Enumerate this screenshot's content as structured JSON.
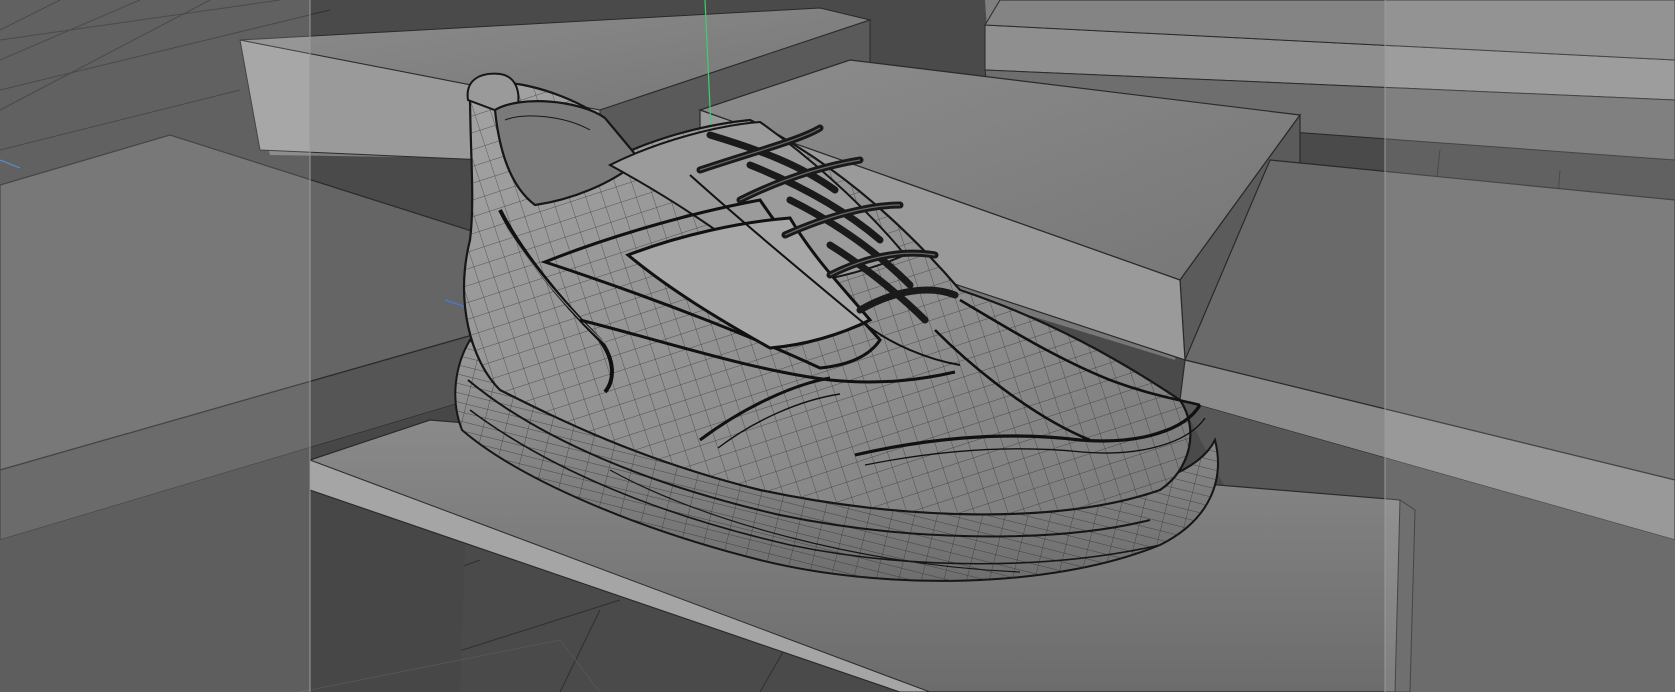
{
  "viewport": {
    "view": "perspective",
    "display_mode": "wireframe-on-shaded",
    "background_color": "#3e3e3e",
    "floor_grid": true
  },
  "colors": {
    "surface_light": "#8e8e8e",
    "surface_mid": "#6a6a6a",
    "surface_dark": "#4c4c4c",
    "wire_dark": "#1c1c1c",
    "wire_grid": "#2e2e2e",
    "axis_green": "#3ccf6e",
    "axis_blue": "#3f7fd0"
  },
  "scene": {
    "objects": [
      {
        "name": "step-back-left",
        "type": "box"
      },
      {
        "name": "step-back-right",
        "type": "box"
      },
      {
        "name": "step-middle",
        "type": "box"
      },
      {
        "name": "step-left-large",
        "type": "box"
      },
      {
        "name": "step-right-lower",
        "type": "box"
      },
      {
        "name": "display-plinth",
        "type": "box"
      },
      {
        "name": "shoe",
        "type": "subdivision-mesh",
        "selected": false
      }
    ],
    "shoe_parts": [
      "heel-pull-tab",
      "collar",
      "heel-counter",
      "quarter-panel",
      "tongue",
      "eyestay",
      "laces",
      "vamp",
      "toe-cap",
      "midsole",
      "outsole"
    ]
  },
  "safe_frame": {
    "visible": true
  }
}
